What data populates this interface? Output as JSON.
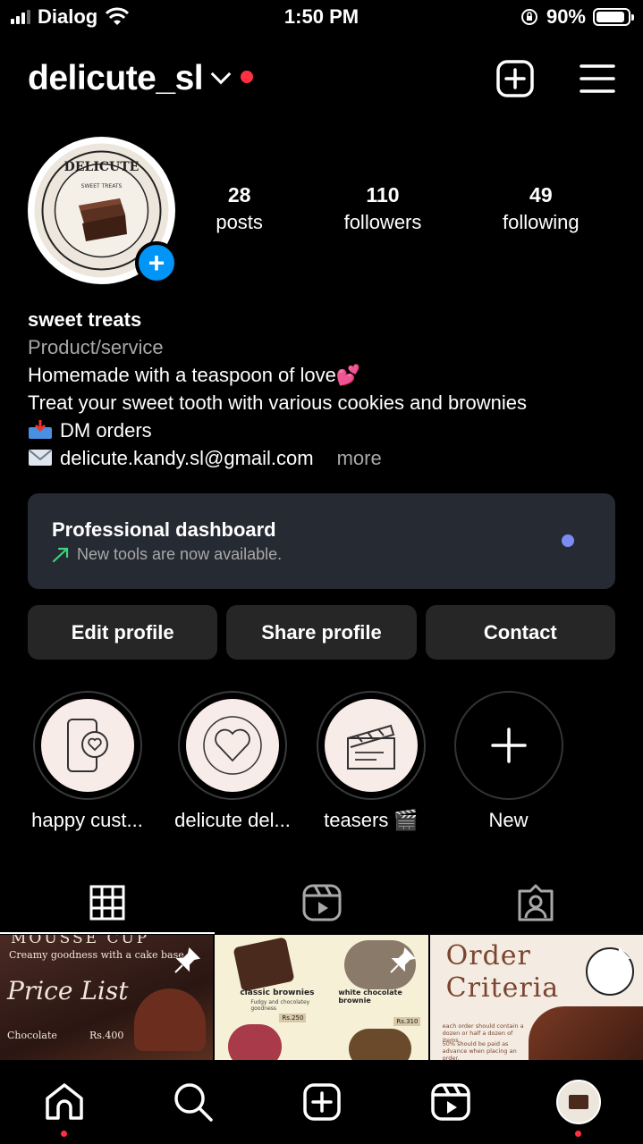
{
  "status_bar": {
    "carrier": "Dialog",
    "time": "1:50 PM",
    "battery": "90%",
    "battery_level": 0.9
  },
  "header": {
    "username": "delicute_sl"
  },
  "profile": {
    "avatar_text": "DELICUTE",
    "avatar_sub": "SWEET TREATS",
    "stats": [
      {
        "num": "28",
        "label": "posts"
      },
      {
        "num": "110",
        "label": "followers"
      },
      {
        "num": "49",
        "label": "following"
      }
    ]
  },
  "bio": {
    "name": "sweet treats",
    "category": "Product/service",
    "line1": "Homemade with a teaspoon of love",
    "line2": "Treat your sweet tooth with various cookies and brownies",
    "line3": "DM orders",
    "line4": "delicute.kandy.sl@gmail.com",
    "more": "more"
  },
  "dashboard": {
    "title": "Professional dashboard",
    "subtitle": "New tools are now available."
  },
  "buttons": {
    "edit": "Edit profile",
    "share": "Share profile",
    "contact": "Contact"
  },
  "highlights": [
    {
      "label": "happy cust...",
      "icon": "phone-heart-icon"
    },
    {
      "label": "delicute del...",
      "icon": "heart-icon"
    },
    {
      "label": "teasers 🎬",
      "icon": "clapperboard-icon"
    },
    {
      "label": "New",
      "icon": "plus-icon"
    }
  ],
  "grid": {
    "post1": {
      "line1": "MOUSSE CUP",
      "line2": "Creamy goodness with a cake base",
      "line3": "Price List",
      "line4": "Chocolate",
      "line5": "Rs.400"
    },
    "post2": {
      "left": "classic brownies",
      "left_sub": "Fudgy and chocolatey goodness",
      "right": "white chocolate brownie",
      "price1": "Rs.250",
      "price2": "Rs.310"
    },
    "post3": {
      "line1": "Order",
      "line2": "Criteria",
      "note1": "each order should contain a dozen or half a dozen of items.",
      "note2": "50% should be paid as advance when placing an order."
    }
  },
  "colors": {
    "accent": "#0095f6",
    "notify": "#ff3040",
    "dashboard_bg": "#262a33",
    "button_bg": "#262626"
  }
}
